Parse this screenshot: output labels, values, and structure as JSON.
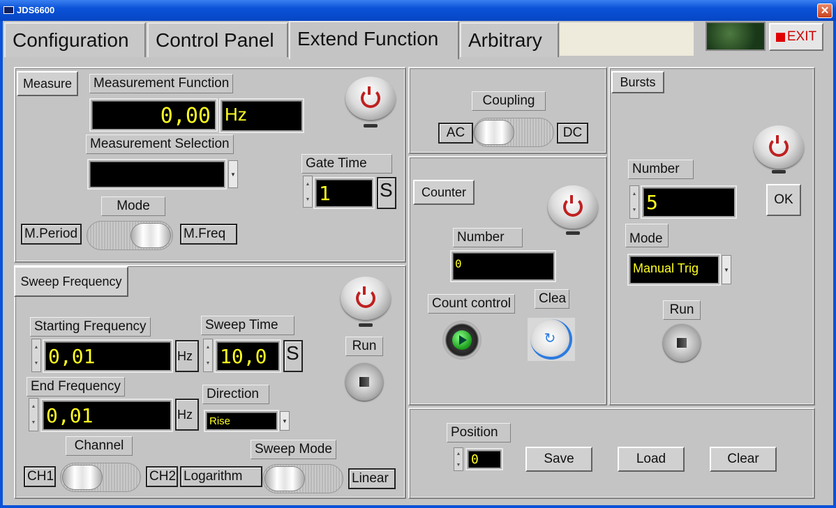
{
  "window": {
    "title": "JDS6600",
    "close_glyph": "✕"
  },
  "tabs": [
    {
      "label": "Configuration"
    },
    {
      "label": "Control Panel"
    },
    {
      "label": "Extend Function"
    },
    {
      "label": "Arbitrary"
    }
  ],
  "exit_label": "EXIT",
  "measure": {
    "button": "Measure",
    "function_label": "Measurement Function",
    "value": "0,00",
    "unit": "Hz",
    "selection_label": "Measurement Selection",
    "selection_value": "",
    "mode_label": "Mode",
    "mode_left": "M.Period",
    "mode_right": "M.Freq",
    "gate_label": "Gate Time",
    "gate_value": "1",
    "gate_unit": "S"
  },
  "sweep": {
    "button": "Sweep Frequency",
    "start_label": "Starting Frequency",
    "start_value": "0,01",
    "start_unit": "Hz",
    "time_label": "Sweep Time",
    "time_value": "10,0",
    "time_unit": "S",
    "end_label": "End Frequency",
    "end_value": "0,01",
    "end_unit": "Hz",
    "direction_label": "Direction",
    "direction_value": "Rise",
    "run_label": "Run",
    "channel_label": "Channel",
    "ch1": "CH1",
    "ch2": "CH2",
    "sweep_mode_label": "Sweep Mode",
    "mode_left": "Logarithm",
    "mode_right": "Linear"
  },
  "coupling": {
    "label": "Coupling",
    "left": "AC",
    "right": "DC"
  },
  "counter": {
    "button": "Counter",
    "number_label": "Number",
    "number_value": "0",
    "count_control_label": "Count control",
    "clear_label": "Clea"
  },
  "bursts": {
    "button": "Bursts",
    "number_label": "Number",
    "number_value": "5",
    "ok_label": "OK",
    "mode_label": "Mode",
    "mode_value": "Manual Trig",
    "run_label": "Run"
  },
  "storage": {
    "position_label": "Position",
    "position_value": "0",
    "save_label": "Save",
    "load_label": "Load",
    "clear_label": "Clear"
  },
  "colors": {
    "display_text": "#ffff20",
    "title_bar": "#0a52d8",
    "exit": "#d00000"
  }
}
